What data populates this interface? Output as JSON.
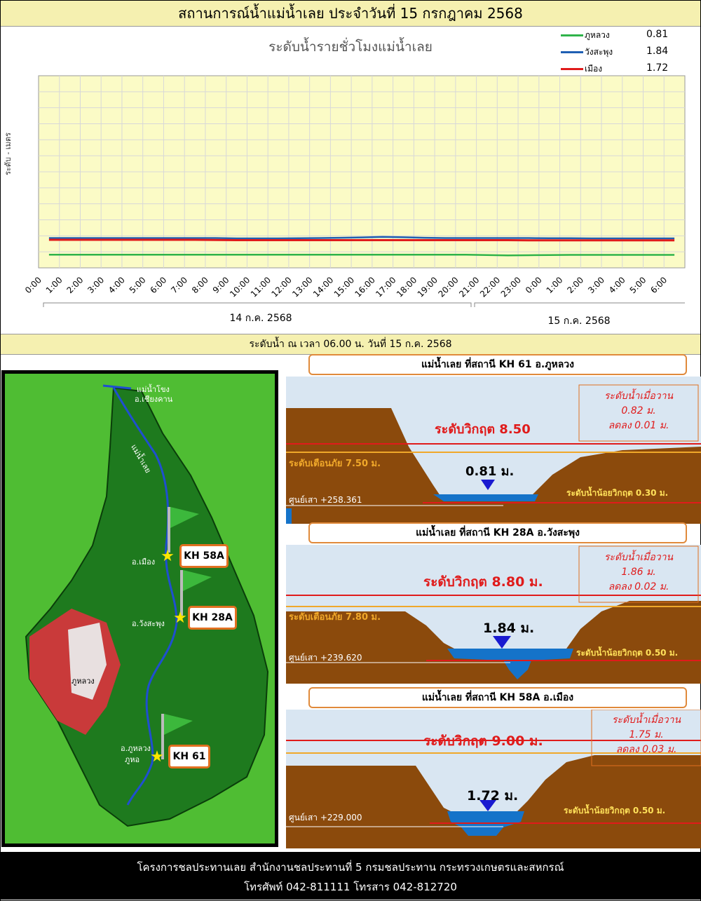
{
  "header": {
    "title": "สถานการณ์น้ำแม่น้ำเลย ประจำวันที่ 15 กรกฎาคม 2568"
  },
  "chart_data": {
    "type": "line",
    "title": "ระดับน้ำรายชั่วโมงแม่น้ำเลย",
    "ylabel": "ระดับ - เมตร",
    "x": [
      "0:00",
      "1:00",
      "2:00",
      "3:00",
      "4:00",
      "5:00",
      "6:00",
      "7:00",
      "8:00",
      "9:00",
      "10:00",
      "11:00",
      "12:00",
      "13:00",
      "14:00",
      "15:00",
      "16:00",
      "17:00",
      "18:00",
      "19:00",
      "20:00",
      "21:00",
      "22:00",
      "23:00",
      "0:00",
      "1:00",
      "2:00",
      "3:00",
      "4:00",
      "5:00",
      "6:00"
    ],
    "date_groups": [
      {
        "label": "14 ก.ค. 2568"
      },
      {
        "label": "15 ก.ค. 2568"
      }
    ],
    "ylim": [
      0,
      12
    ],
    "grid": true,
    "legend_position": "top-right",
    "series": [
      {
        "name": "ภูหลวง",
        "color": "#2fb34a",
        "latest": "0.81",
        "values": [
          0.82,
          0.82,
          0.82,
          0.82,
          0.82,
          0.82,
          0.82,
          0.82,
          0.82,
          0.82,
          0.82,
          0.82,
          0.82,
          0.82,
          0.82,
          0.82,
          0.82,
          0.82,
          0.82,
          0.82,
          0.82,
          0.8,
          0.78,
          0.79,
          0.8,
          0.81,
          0.81,
          0.81,
          0.81,
          0.81,
          0.81
        ]
      },
      {
        "name": "วังสะพุง",
        "color": "#1f5fb3",
        "latest": "1.84",
        "values": [
          1.86,
          1.86,
          1.86,
          1.86,
          1.86,
          1.86,
          1.86,
          1.86,
          1.86,
          1.84,
          1.84,
          1.84,
          1.85,
          1.86,
          1.88,
          1.9,
          1.93,
          1.91,
          1.88,
          1.86,
          1.86,
          1.86,
          1.86,
          1.86,
          1.85,
          1.85,
          1.84,
          1.84,
          1.84,
          1.84,
          1.84
        ]
      },
      {
        "name": "เมือง",
        "color": "#e01b1b",
        "latest": "1.72",
        "values": [
          1.75,
          1.75,
          1.75,
          1.75,
          1.75,
          1.75,
          1.75,
          1.75,
          1.74,
          1.73,
          1.73,
          1.73,
          1.73,
          1.73,
          1.73,
          1.73,
          1.73,
          1.73,
          1.73,
          1.73,
          1.73,
          1.73,
          1.73,
          1.72,
          1.72,
          1.72,
          1.72,
          1.72,
          1.72,
          1.72,
          1.72
        ]
      }
    ]
  },
  "section": {
    "title": "ระดับน้ำ ณ เวลา 06.00 น. วันที่ 15 ก.ค. 2568"
  },
  "map": {
    "labels": {
      "mekong": "แม่น้ำโขง",
      "chiang_khan": "อ.เชียงคาน",
      "loei_river": "แม่น้ำเลย",
      "mueang": "อ.เมือง",
      "wang_saphung": "อ.วังสะพุง",
      "phu_luang_mtn": "ภูหลวง",
      "phu_luang_dist": "อ.ภูหลวง",
      "phu_ho": "ภูหอ"
    },
    "stations": [
      "KH 58A",
      "KH 28A",
      "KH 61"
    ]
  },
  "cross_sections": [
    {
      "header": "แม่น้ำเลย  ที่สถานี KH 61 อ.ภูหลวง",
      "critical": "ระดับวิกฤต 8.50",
      "warning": "ระดับเตือนภัย 7.50 ม.",
      "level": "0.81 ม.",
      "zero": "ศูนย์เสา +258.361",
      "low": "ระดับน้ำน้อยวิกฤต 0.30 ม.",
      "yesterday_label": "ระดับน้ำเมื่อวาน",
      "yesterday_value": "0.82 ม.",
      "change": "ลดลง 0.01 ม."
    },
    {
      "header": "แม่น้ำเลย  ที่สถานี KH 28A อ.วังสะพุง",
      "critical": "ระดับวิกฤต 8.80 ม.",
      "warning": "ระดับเตือนภัย 7.80 ม.",
      "level": "1.84 ม.",
      "zero": "ศูนย์เสา +239.620",
      "low": "ระดับน้ำน้อยวิกฤต 0.50 ม.",
      "yesterday_label": "ระดับน้ำเมื่อวาน",
      "yesterday_value": "1.86 ม.",
      "change": "ลดลง 0.02 ม."
    },
    {
      "header": "แม่น้ำเลย  ที่สถานี KH 58A อ.เมือง",
      "critical": "ระดับวิกฤต 9.00 ม.",
      "warning": "",
      "level": "1.72 ม.",
      "zero": "ศูนย์เสา +229.000",
      "low": "ระดับน้ำน้อยวิกฤต 0.50 ม.",
      "yesterday_label": "ระดับน้ำเมื่อวาน",
      "yesterday_value": "1.75 ม.",
      "change": "ลดลง 0.03 ม."
    }
  ],
  "footer": {
    "line1": "โครงการชลประทานเลย  สำนักงานชลประทานที่  5  กรมชลประทาน  กระทรวงเกษตรและสหกรณ์",
    "line2": "โทรศัพท์ 042-811111 โทรสาร 042-812720"
  }
}
